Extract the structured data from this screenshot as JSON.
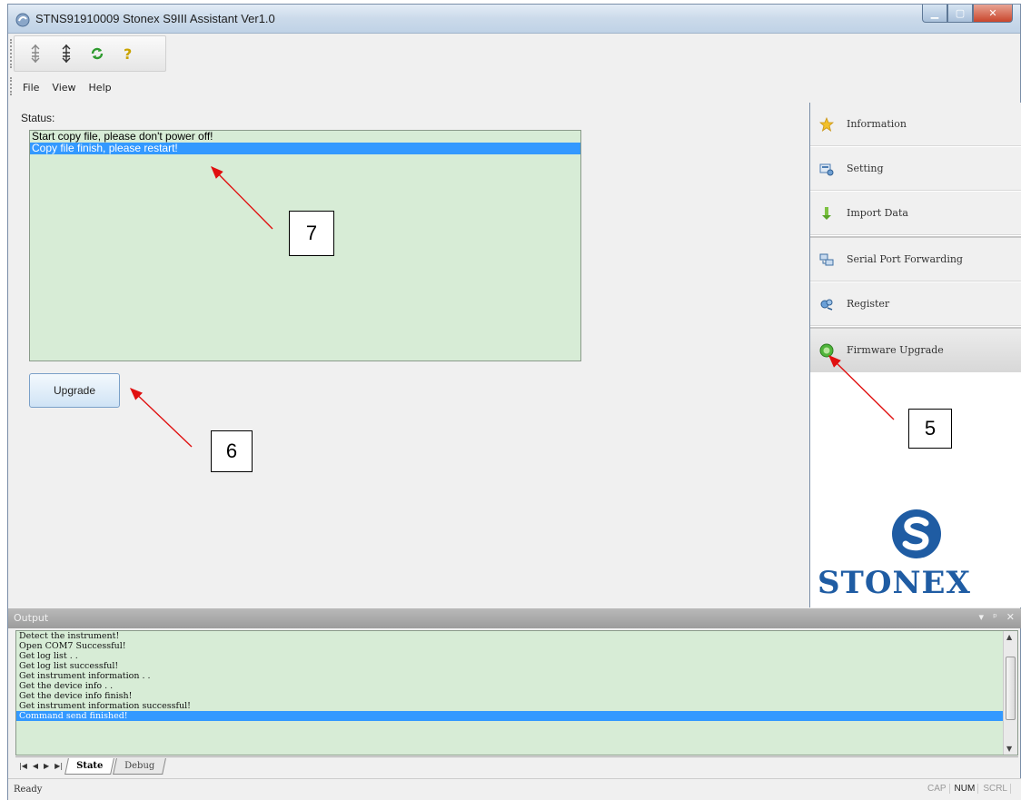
{
  "window": {
    "title": "STNS91910009 Stonex S9III Assistant Ver1.0"
  },
  "toolbar": {
    "buttons": [
      "connect-icon",
      "disconnect-icon",
      "refresh-icon",
      "help-icon"
    ]
  },
  "menu": {
    "items": [
      "File",
      "View",
      "Help"
    ]
  },
  "status": {
    "label": "Status:",
    "lines": [
      {
        "text": "Start copy file, please don't power off!",
        "selected": false
      },
      {
        "text": "Copy file finish, please restart!",
        "selected": true
      }
    ]
  },
  "upgrade_button": "Upgrade",
  "sidebar": {
    "items": [
      {
        "label": "Information",
        "icon": "star-icon"
      },
      {
        "label": "Setting",
        "icon": "settings-icon"
      },
      {
        "label": "Import Data",
        "icon": "import-icon"
      },
      {
        "label": "Serial Port Forwarding",
        "icon": "serial-port-icon"
      },
      {
        "label": "Register",
        "icon": "register-icon"
      },
      {
        "label": "Firmware Upgrade",
        "icon": "firmware-icon",
        "active": true
      }
    ],
    "logo_text": "STONEX"
  },
  "callouts": {
    "five": "5",
    "six": "6",
    "seven": "7"
  },
  "output": {
    "title": "Output",
    "lines": [
      "Detect the instrument!",
      "Open COM7 Successful!",
      "Get log list . .",
      "Get log list successful!",
      "Get instrument information . .",
      "Get the device info . .",
      "Get the device info finish!",
      "Get instrument information successful!",
      "Command send finished!"
    ],
    "selected_index": 8
  },
  "tabs": {
    "active": "State",
    "inactive": "Debug"
  },
  "statusbar": {
    "ready": "Ready",
    "cap": "CAP",
    "num": "NUM",
    "scrl": "SCRL"
  },
  "colors": {
    "status_bg": "#d7ecd6",
    "selection": "#3399ff",
    "brand": "#1f5ca3"
  }
}
